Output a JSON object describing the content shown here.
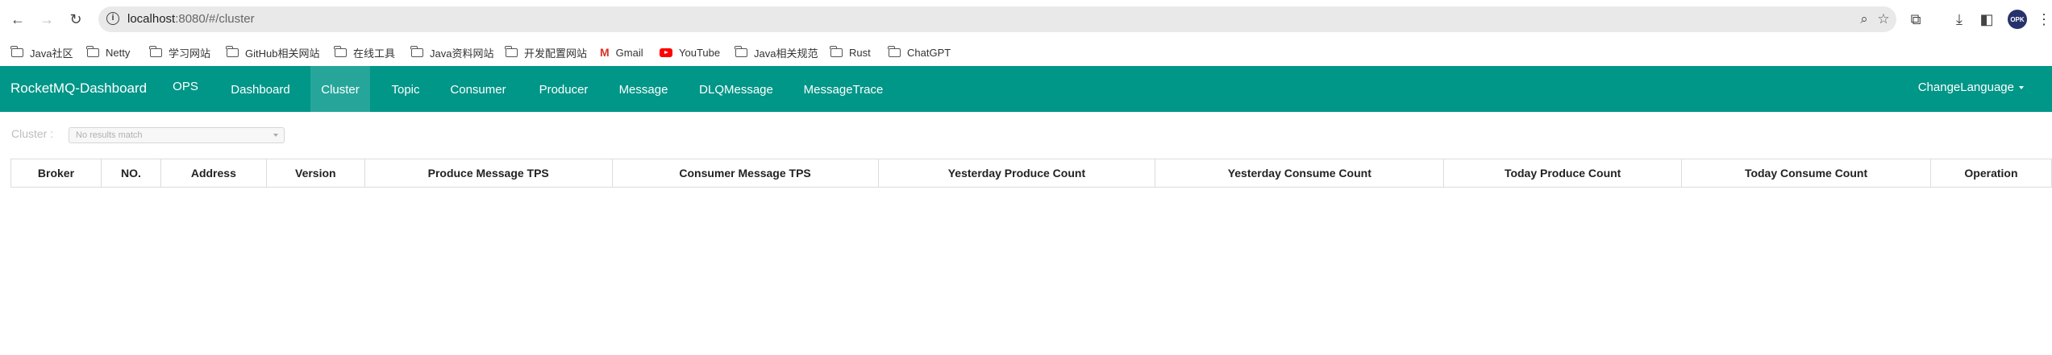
{
  "browser": {
    "url_host": "localhost",
    "url_path": ":8080/#/cluster",
    "profile_label": "OPK"
  },
  "bookmarks": [
    {
      "label": "Java社区",
      "icon": "folder-icon"
    },
    {
      "label": "Netty",
      "icon": "folder-icon"
    },
    {
      "label": "学习网站",
      "icon": "folder-icon"
    },
    {
      "label": "GitHub相关网站",
      "icon": "folder-icon"
    },
    {
      "label": "在线工具",
      "icon": "folder-icon"
    },
    {
      "label": "Java资料网站",
      "icon": "folder-icon"
    },
    {
      "label": "开发配置网站",
      "icon": "folder-icon"
    },
    {
      "label": "Gmail",
      "icon": "gmail-icon"
    },
    {
      "label": "YouTube",
      "icon": "youtube-icon"
    },
    {
      "label": "Java相关规范",
      "icon": "folder-icon"
    },
    {
      "label": "Rust",
      "icon": "folder-icon"
    },
    {
      "label": "ChatGPT",
      "icon": "folder-icon"
    }
  ],
  "app": {
    "brand": "RocketMQ-Dashboard",
    "nav": [
      {
        "label": "OPS",
        "active": false
      },
      {
        "label": "Dashboard",
        "active": false
      },
      {
        "label": "Cluster",
        "active": true
      },
      {
        "label": "Topic",
        "active": false
      },
      {
        "label": "Consumer",
        "active": false
      },
      {
        "label": "Producer",
        "active": false
      },
      {
        "label": "Message",
        "active": false
      },
      {
        "label": "DLQMessage",
        "active": false
      },
      {
        "label": "MessageTrace",
        "active": false
      }
    ],
    "language_label": "ChangeLanguage",
    "accent_color": "#009688",
    "active_color": "#26a69a"
  },
  "filter": {
    "label": "Cluster :",
    "placeholder": "No results match"
  },
  "table": {
    "columns": [
      "Broker",
      "NO.",
      "Address",
      "Version",
      "Produce Message TPS",
      "Consumer Message TPS",
      "Yesterday Produce Count",
      "Yesterday Consume Count",
      "Today Produce Count",
      "Today Consume Count",
      "Operation"
    ],
    "rows": []
  }
}
